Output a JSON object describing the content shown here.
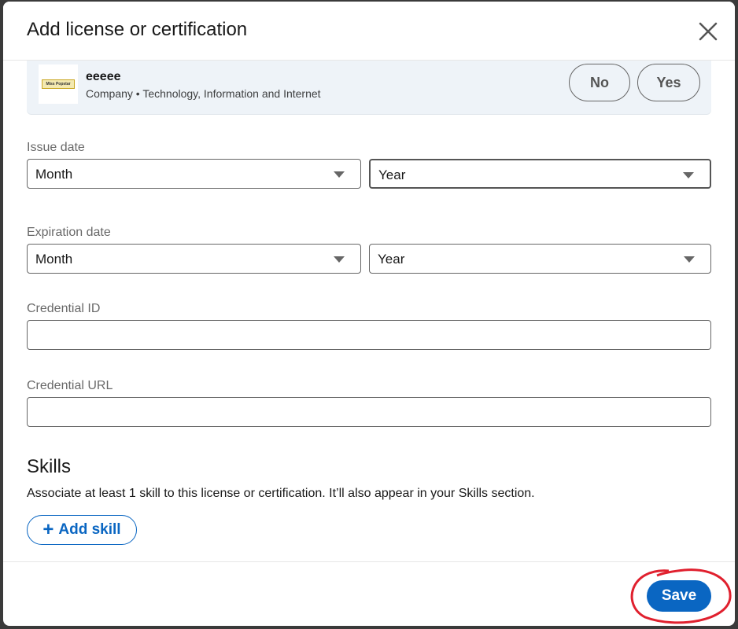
{
  "modal": {
    "title": "Add license or certification",
    "close_icon": "close-icon"
  },
  "company_card": {
    "logo_text": "Miss Popstar",
    "name": "eeeee",
    "description": "Company • Technology, Information and Internet",
    "no_label": "No",
    "yes_label": "Yes"
  },
  "issue_date": {
    "label": "Issue date",
    "month": "Month",
    "year": "Year"
  },
  "expiration_date": {
    "label": "Expiration date",
    "month": "Month",
    "year": "Year"
  },
  "credential_id": {
    "label": "Credential ID",
    "value": ""
  },
  "credential_url": {
    "label": "Credential URL",
    "value": ""
  },
  "skills": {
    "heading": "Skills",
    "description": "Associate at least 1 skill to this license or certification. It’ll also appear in your Skills section.",
    "add_skill_label": "Add skill",
    "add_icon": "plus-icon"
  },
  "footer": {
    "save_label": "Save",
    "accent_color": "#0a66c2",
    "annotation_color": "#e0202e"
  }
}
